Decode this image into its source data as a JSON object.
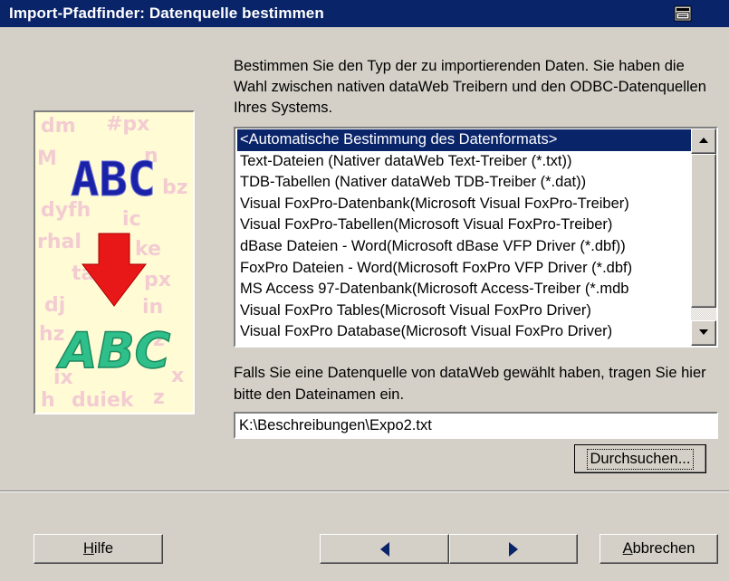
{
  "window": {
    "title": "Import-Pfadfinder: Datenquelle bestimmen"
  },
  "illustration": {
    "text_top": "ABC",
    "text_bottom": "ABC",
    "colors": {
      "top_text": "#2a33b8",
      "arrow": "#e81818",
      "bottom_text": "#2fbf8a",
      "background": "#fffbd5",
      "background_letters": "#f2c4d2"
    }
  },
  "description": "Bestimmen Sie den Typ der zu importierenden Daten. Sie haben die Wahl zwischen nativen dataWeb Treibern und den ODBC-Datenquellen Ihres Systems.",
  "datasource_list": {
    "items": [
      "<Automatische Bestimmung des Datenformats>",
      "Text-Dateien (Nativer dataWeb Text-Treiber (*.txt))",
      "TDB-Tabellen (Nativer dataWeb TDB-Treiber (*.dat))",
      "Visual FoxPro-Datenbank(Microsoft Visual FoxPro-Treiber)",
      "Visual FoxPro-Tabellen(Microsoft Visual FoxPro-Treiber)",
      "dBase Dateien - Word(Microsoft dBase VFP Driver (*.dbf))",
      "FoxPro Dateien - Word(Microsoft FoxPro VFP Driver (*.dbf)",
      "MS Access 97-Datenbank(Microsoft Access-Treiber (*.mdb",
      "Visual FoxPro Tables(Microsoft Visual FoxPro Driver)",
      "Visual FoxPro Database(Microsoft Visual FoxPro Driver)"
    ],
    "selected_index": 0
  },
  "file_hint": "Falls Sie eine Datenquelle von dataWeb gewählt haben, tragen Sie hier bitte den Dateinamen ein.",
  "path_input": {
    "value": "K:\\Beschreibungen\\Expo2.txt"
  },
  "browse_button": {
    "label": "Durchsuchen..."
  },
  "footer": {
    "help_label": "Hilfe",
    "help_mnemonic": "H",
    "back_icon": "left-triangle",
    "next_icon": "right-triangle",
    "cancel_label": "Abbrechen",
    "cancel_mnemonic": "A"
  }
}
